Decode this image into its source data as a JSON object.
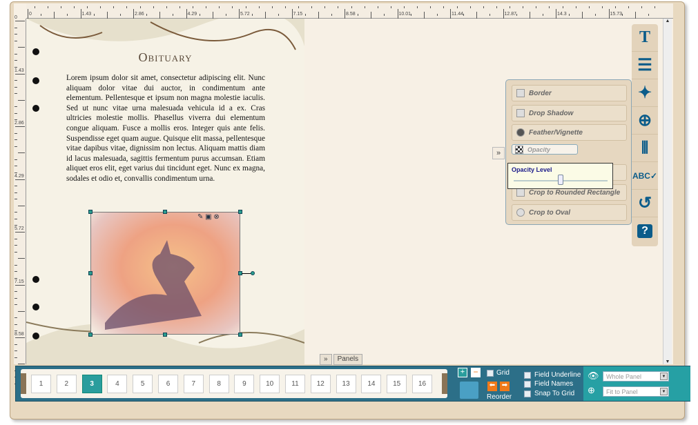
{
  "ruler": {
    "top": [
      "0",
      "1.43",
      "2.86",
      "4.29",
      "5.72",
      "7.15",
      "8.58",
      "10.01",
      "11.44",
      "12.87",
      "14.3",
      "15.73"
    ],
    "left": [
      "0",
      "1.43",
      "2.86",
      "4.29",
      "5.72",
      "7.15",
      "8.58"
    ]
  },
  "page": {
    "title": "Obituary",
    "body": "Lorem ipsum dolor sit amet, consectetur adipiscing elit. Nunc aliquam dolor vitae dui auctor, in condimentum ante elementum. Pellentesque et ipsum non magna molestie iaculis. Sed ut nunc vitae urna malesuada vehicula id a ex. Cras ultricies molestie mollis. Phasellus viverra dui elementum congue aliquam. Fusce a mollis eros. Integer quis ante felis. Suspendisse eget quam augue. Quisque elit massa, pellentesque vitae dapibus vitae, dignissim non lectus. Aliquam mattis diam id lacus malesuada, sagittis fermentum purus accumsan. Etiam aliquet eros elit, eget varius dui tincidunt eget. Nunc ex magna, sodales et odio et, convallis condimentum urna."
  },
  "image_options": {
    "items": [
      "Border",
      "Drop Shadow",
      "Feather/Vignette",
      "Opacity",
      "",
      "Crop to Rounded Rectangle",
      "Crop to Oval"
    ],
    "selected": "Opacity",
    "tooltip": {
      "label": "Opacity Level",
      "value_percent": 50
    }
  },
  "tools": [
    "text-icon",
    "align-icon",
    "magic-wand-icon",
    "add-icon",
    "distribute-icon",
    "spellcheck-icon",
    "undo-icon",
    "help-icon"
  ],
  "panels_label": "Panels",
  "pages": {
    "items": [
      "1",
      "2",
      "3",
      "4",
      "5",
      "6",
      "7",
      "8",
      "9",
      "10",
      "11",
      "12",
      "13",
      "14",
      "15",
      "16"
    ],
    "current": "3"
  },
  "controls": {
    "grid": "Grid",
    "reorder": "Reorder",
    "field_underline": "Field Underline",
    "field_names": "Field Names",
    "snap_to_grid": "Snap To Grid",
    "view_select": "Whole Panel",
    "zoom_select": "Fit to Panel"
  },
  "colors": {
    "accent": "#2a9d9d",
    "bar": "#2c6f88",
    "tool_icon": "#0b5c8a"
  }
}
